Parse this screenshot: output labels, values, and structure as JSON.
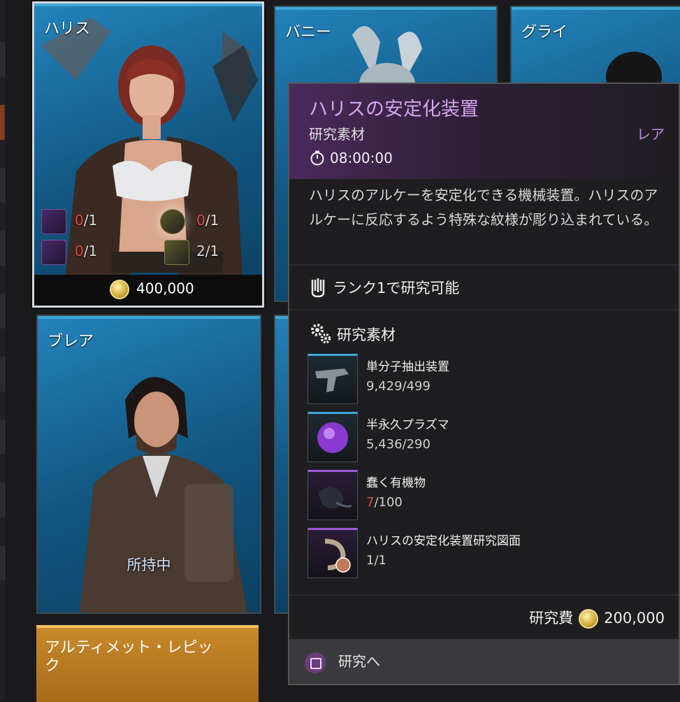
{
  "cards": {
    "harris": {
      "name": "ハリス",
      "mat_counts": [
        "0",
        "/1",
        "0",
        "/1",
        "0",
        "/1",
        "2/1"
      ],
      "price": "400,000"
    },
    "bunny": {
      "name": "バニー"
    },
    "gley": {
      "name": "グライ"
    },
    "blair": {
      "name": "ブレア",
      "status": "所持中"
    },
    "ultimate": {
      "label": "アルティメット・レピッ",
      "label2": "ク"
    }
  },
  "tooltip": {
    "title": "ハリスの安定化装置",
    "type": "研究素材",
    "rarity": "レア",
    "timer": "08:00:00",
    "description": "ハリスのアルケーを安定化できる機械装置。ハリスのアルケーに反応するよう特殊な紋様が彫り込まれている。",
    "rank_requirement": "ランク1で研究可能",
    "materials_header": "研究素材",
    "materials": [
      {
        "name": "単分子抽出装置",
        "qty": "9,429/499",
        "icon": "gun-device-icon"
      },
      {
        "name": "半永久プラズマ",
        "qty": "5,436/290",
        "icon": "plasma-orb-icon"
      },
      {
        "name": "蠢く有機物",
        "qty_have": "7",
        "qty_need": "/100",
        "icon": "organic-creature-icon"
      },
      {
        "name": "ハリスの安定化装置研究図面",
        "qty": "1/1",
        "icon": "blueprint-icon"
      }
    ],
    "cost_label": "研究費",
    "cost": "200,000",
    "action_label": "研究へ"
  },
  "colors": {
    "accent_purple": "#d6a4f0",
    "rarity": "#c48ae6",
    "insufficient": "#e44a4a",
    "card_blue": "#1a6fa4"
  }
}
